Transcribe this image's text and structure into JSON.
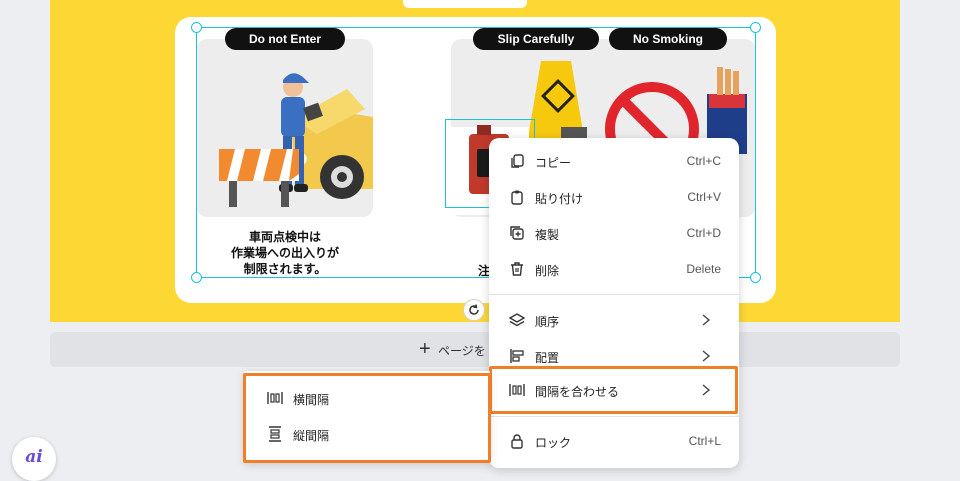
{
  "canvas": {
    "labels": [
      "Do not Enter",
      "Slip Carefully",
      "No Smoking"
    ],
    "caption_lines": [
      "車両点検中は",
      "作業場への出入りが",
      "制限されます。"
    ],
    "caption2_partial": "注"
  },
  "add_page": {
    "label": "ページを追加"
  },
  "context_menu": {
    "items": [
      {
        "label": "コピー",
        "shortcut": "Ctrl+C",
        "icon": "copy-icon"
      },
      {
        "label": "貼り付け",
        "shortcut": "Ctrl+V",
        "icon": "paste-icon"
      },
      {
        "label": "複製",
        "shortcut": "Ctrl+D",
        "icon": "duplicate-icon"
      },
      {
        "label": "削除",
        "shortcut": "Delete",
        "icon": "trash-icon"
      },
      {
        "label": "順序",
        "icon": "layers-icon"
      },
      {
        "label": "配置",
        "icon": "align-icon"
      },
      {
        "label": "間隔を合わせる",
        "icon": "spacing-icon"
      },
      {
        "label": "ロック",
        "shortcut": "Ctrl+L",
        "icon": "lock-icon"
      }
    ]
  },
  "submenu": {
    "items": [
      {
        "label": "横間隔",
        "icon": "horizontal-spacing-icon"
      },
      {
        "label": "縦間隔",
        "icon": "vertical-spacing-icon"
      }
    ]
  },
  "ai_button": {
    "label": "ai"
  },
  "colors": {
    "selection": "#19c3d8",
    "highlight": "#f07f2a",
    "page_background": "#fdd835"
  }
}
